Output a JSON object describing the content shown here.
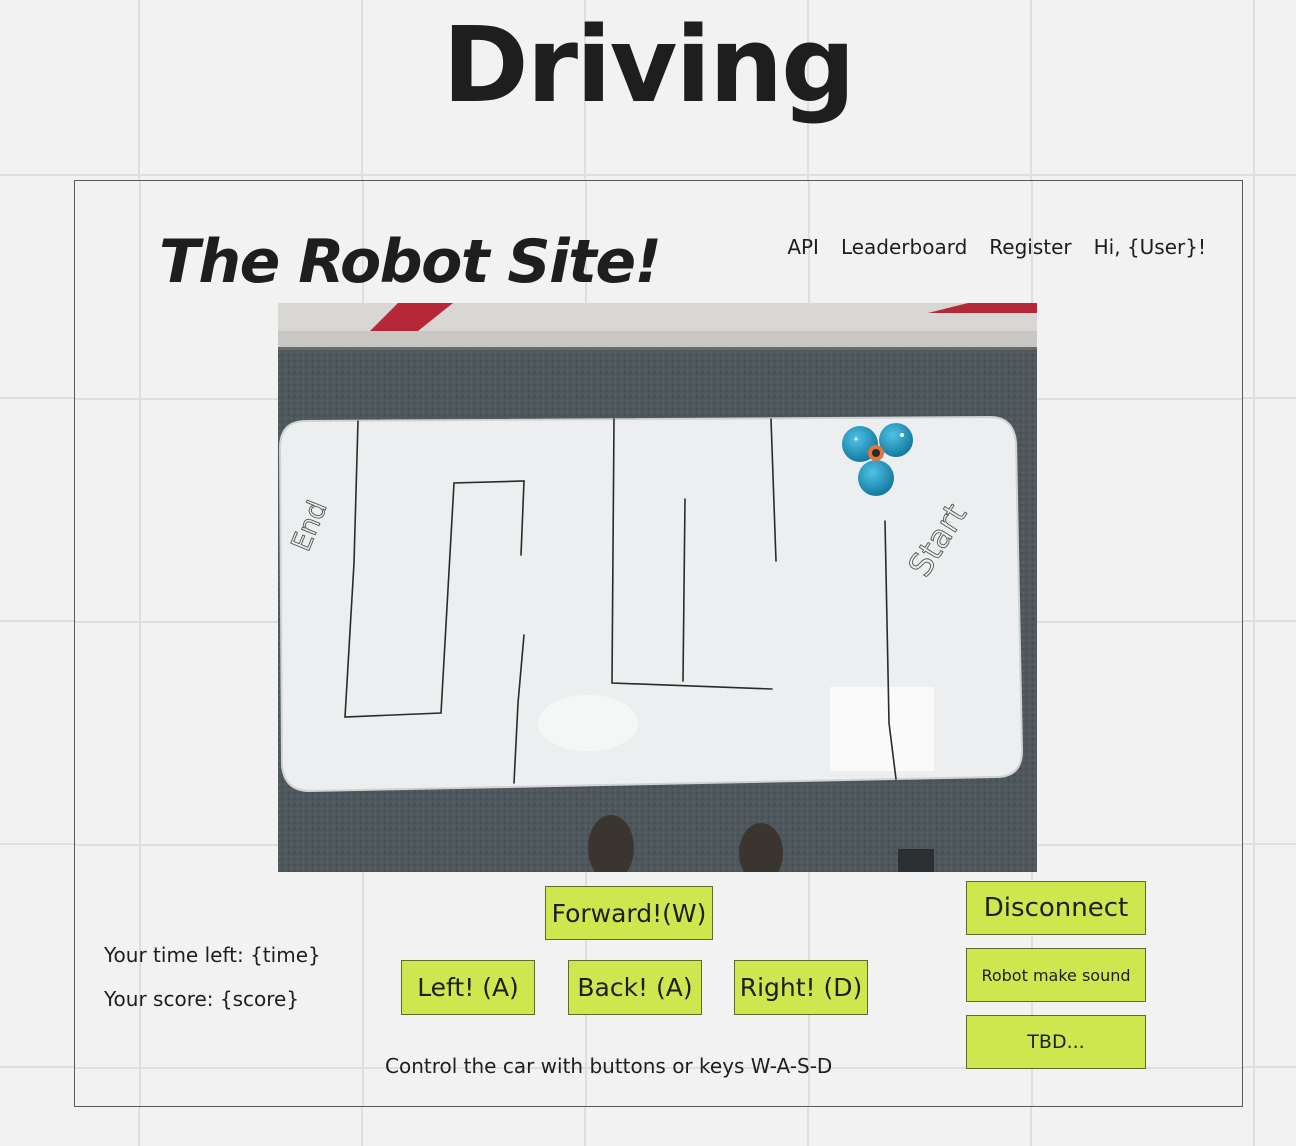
{
  "page": {
    "title": "Driving"
  },
  "header": {
    "site_title": "The Robot Site!",
    "nav": {
      "api": "API",
      "leaderboard": "Leaderboard",
      "register": "Register",
      "greeting": "Hi, {User}!"
    }
  },
  "camera": {
    "maze_labels": {
      "start": "Start",
      "end": "End"
    }
  },
  "stats": {
    "time": "Your time left: {time}",
    "score": "Your score: {score}"
  },
  "controls": {
    "forward": "Forward!(W)",
    "left": "Left! (A)",
    "back": "Back! (A)",
    "right": "Right! (D)",
    "hint": "Control the car with buttons or keys W-A-S-D"
  },
  "actions": {
    "disconnect": "Disconnect",
    "sound": "Robot make sound",
    "tbd": "TBD..."
  },
  "colors": {
    "button": "#cee74e",
    "background": "#f2f2f2",
    "text": "#1e1e1e"
  }
}
